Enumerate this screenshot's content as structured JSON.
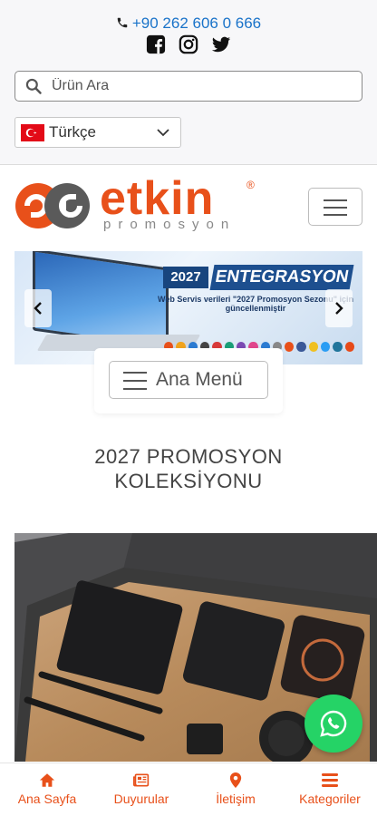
{
  "contact": {
    "phone": "+90 262 606 0 666",
    "social": [
      "facebook-icon",
      "instagram-icon",
      "twitter-icon"
    ]
  },
  "search": {
    "placeholder": "Ürün Ara"
  },
  "language": {
    "selected": "Türkçe"
  },
  "brand": {
    "name": "etkin",
    "tagline": "promosyon",
    "registered": "®"
  },
  "slider": {
    "year": "2027",
    "title": "ENTEGRASYON",
    "line1": "Web Servis verileri \"2027 Promosyon Sezonu\" için güncellenmiştir",
    "line2": "",
    "line3": ""
  },
  "main_menu": {
    "label": "Ana Menü"
  },
  "collection": {
    "title_line1": "2027 PROMOSYON",
    "title_line2": "KOLEKSİYONU"
  },
  "bottom_nav": {
    "home": "Ana Sayfa",
    "news": "Duyurular",
    "contact": "İletişim",
    "categories": "Kategoriler"
  },
  "colors": {
    "brand_orange": "#e8501a",
    "link_blue": "#1a73c9",
    "whatsapp_green": "#25d366"
  }
}
